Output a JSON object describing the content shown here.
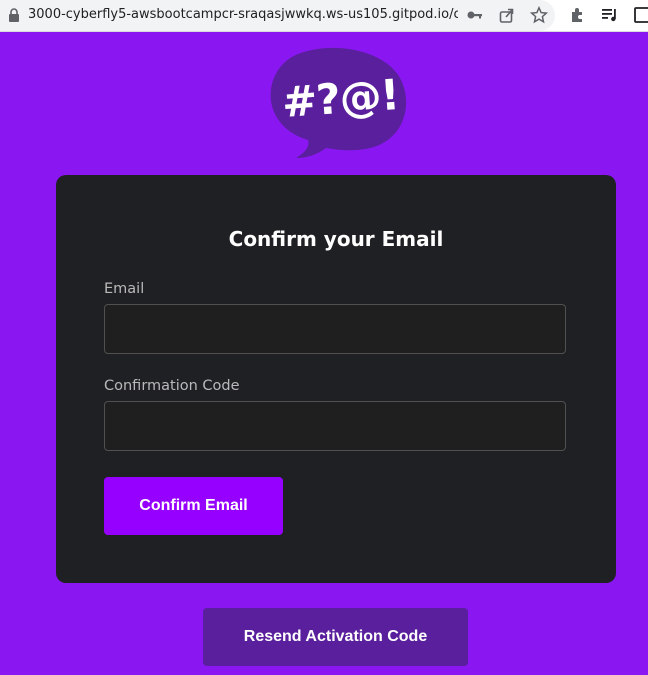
{
  "browser": {
    "url": "3000-cyberfly5-awsbootcampcr-sraqasjwwkq.ws-us105.gitpod.io/c..."
  },
  "logo": {
    "text": "#?@!"
  },
  "form": {
    "title": "Confirm your Email",
    "email_label": "Email",
    "email_value": "",
    "code_label": "Confirmation Code",
    "code_value": "",
    "confirm_label": "Confirm Email"
  },
  "resend_label": "Resend Activation Code",
  "colors": {
    "page_bg": "#8a17f2",
    "card_bg": "#1f2023",
    "primary_button": "#9500ff",
    "secondary_button": "#5a1f9c",
    "logo_bubble": "#5a1f9c"
  },
  "icons": [
    "lock-icon",
    "key-icon",
    "share-icon",
    "star-icon",
    "extensions-icon",
    "media-control-icon",
    "sidebar-icon"
  ]
}
